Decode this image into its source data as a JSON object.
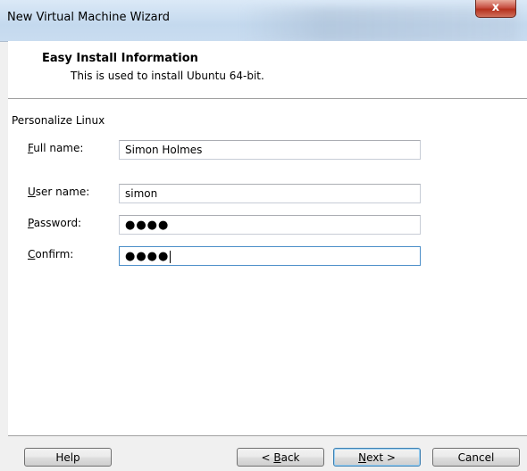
{
  "window": {
    "title": "New Virtual Machine Wizard",
    "close_label": "x"
  },
  "header": {
    "title": "Easy Install Information",
    "subtitle": "This is used to install Ubuntu 64-bit."
  },
  "form": {
    "section_label": "Personalize Linux",
    "full_name": {
      "label_first": "F",
      "label_rest": "ull name:",
      "value": "Simon Holmes"
    },
    "user_name": {
      "label_first": "U",
      "label_rest": "ser name:",
      "value": "simon"
    },
    "password": {
      "label_first": "P",
      "label_rest": "assword:",
      "value_masked": "●●●●"
    },
    "confirm": {
      "label_first": "C",
      "label_rest": "onfirm:",
      "value_masked": "●●●●"
    }
  },
  "buttons": {
    "help": "Help",
    "back_prefix": "< ",
    "back_first": "B",
    "back_rest": "ack",
    "next_first": "N",
    "next_rest": "ext >",
    "cancel": "Cancel"
  },
  "colors": {
    "window_bg": "#f0f0f0",
    "close_button": "#c75042",
    "focus_border": "#4c8fc9"
  }
}
